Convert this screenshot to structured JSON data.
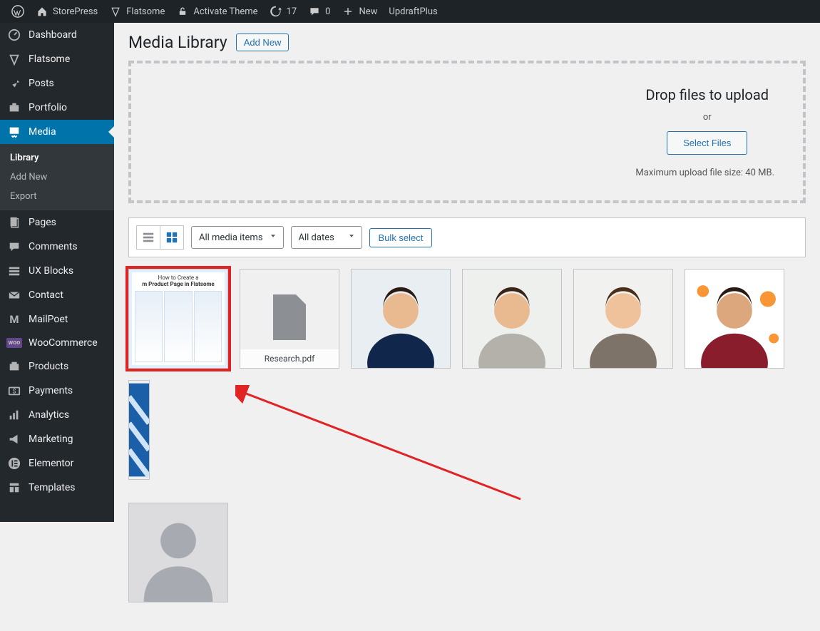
{
  "adminbar": {
    "site_name": "StorePress",
    "theme": "Flatsome",
    "activate": "Activate Theme",
    "updates_count": "17",
    "comments_count": "0",
    "new_label": "New",
    "updraft": "UpdraftPlus"
  },
  "sidebar": {
    "items": [
      {
        "label": "Dashboard",
        "icon": "dashboard"
      },
      {
        "label": "Flatsome",
        "icon": "diamond"
      },
      {
        "label": "Posts",
        "icon": "pin"
      },
      {
        "label": "Portfolio",
        "icon": "portfolio"
      },
      {
        "label": "Media",
        "icon": "media",
        "active": true,
        "submenu": [
          {
            "label": "Library",
            "current": true
          },
          {
            "label": "Add New"
          },
          {
            "label": "Export"
          }
        ]
      },
      {
        "label": "Pages",
        "icon": "pages"
      },
      {
        "label": "Comments",
        "icon": "comments"
      },
      {
        "label": "UX Blocks",
        "icon": "blocks"
      },
      {
        "label": "Contact",
        "icon": "mail"
      },
      {
        "label": "MailPoet",
        "icon": "mailpoet"
      },
      {
        "label": "WooCommerce",
        "icon": "woo"
      },
      {
        "label": "Products",
        "icon": "products"
      },
      {
        "label": "Payments",
        "icon": "payments"
      },
      {
        "label": "Analytics",
        "icon": "analytics"
      },
      {
        "label": "Marketing",
        "icon": "marketing"
      },
      {
        "label": "Elementor",
        "icon": "elementor"
      },
      {
        "label": "Templates",
        "icon": "templates"
      }
    ]
  },
  "page": {
    "title": "Media Library",
    "add_new": "Add New"
  },
  "dropzone": {
    "heading": "Drop files to upload",
    "or": "or",
    "select": "Select Files",
    "limit": "Maximum upload file size: 40 MB."
  },
  "toolbar": {
    "filter_type": "All media items",
    "filter_date": "All dates",
    "bulk": "Bulk select"
  },
  "media_items": [
    {
      "kind": "selected_thumb",
      "title_line1": "How to Create a",
      "title_line2": "m Product Page in Flatsome"
    },
    {
      "kind": "document",
      "filename": "Research.pdf"
    },
    {
      "kind": "person",
      "bg": "#e8eef2",
      "shirt": "#10264a",
      "hair": "#2b1a12",
      "skin": "#e9b98f"
    },
    {
      "kind": "person",
      "bg": "#eef0ee",
      "shirt": "#b4b0aa",
      "hair": "#3a2418",
      "skin": "#e9b98f"
    },
    {
      "kind": "person",
      "bg": "#f1f1ef",
      "shirt": "#7e7368",
      "hair": "#4b2f1a",
      "skin": "#efc29b"
    },
    {
      "kind": "person",
      "bg": "#fff",
      "shirt": "#8a1d2b",
      "hair": "#2a1b12",
      "skin": "#dca77d",
      "splatter": "#f78b1f"
    },
    {
      "kind": "abstract"
    },
    {
      "kind": "avatar"
    }
  ]
}
